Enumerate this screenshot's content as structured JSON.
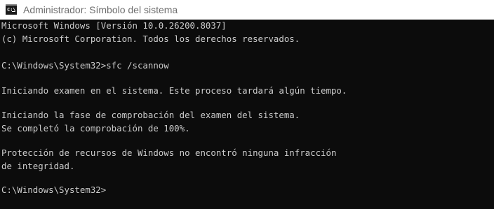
{
  "window": {
    "title": "Administrador: Símbolo del sistema",
    "icon": "command-prompt-icon",
    "icon_glyph": "C:\\"
  },
  "console": {
    "lines": [
      "Microsoft Windows [Versión 10.0.26200.8037]",
      "(c) Microsoft Corporation. Todos los derechos reservados.",
      "",
      "C:\\Windows\\System32>sfc /scannow",
      "",
      "Iniciando examen en el sistema. Este proceso tardará algún tiempo.",
      "",
      "Iniciando la fase de comprobación del examen del sistema.",
      "Se completó la comprobación de 100%.",
      "",
      "Protección de recursos de Windows no encontró ninguna infracción",
      "de integridad.",
      "",
      "C:\\Windows\\System32>"
    ]
  },
  "colors": {
    "console_background": "#0c0c0c",
    "console_text": "#cccccc",
    "titlebar_background": "#ffffff",
    "title_text": "#6e6e6e"
  }
}
